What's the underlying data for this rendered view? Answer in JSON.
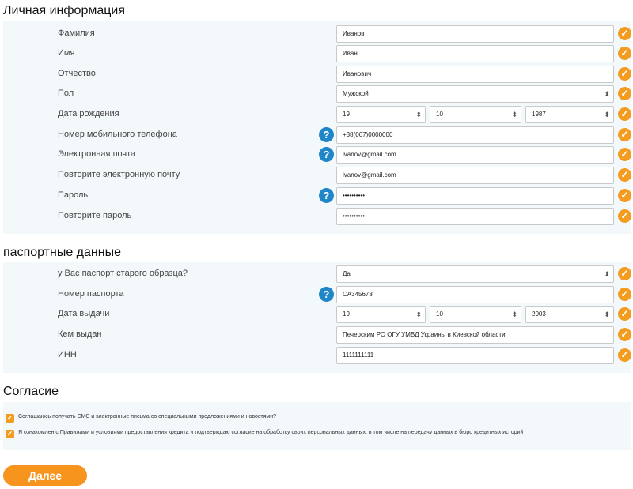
{
  "personal": {
    "title": "Личная информация",
    "fields": [
      {
        "label": "Фамилия",
        "value": "Иванов"
      },
      {
        "label": "Имя",
        "value": "Иван"
      },
      {
        "label": "Отчество",
        "value": "Иванович"
      },
      {
        "label": "Пол",
        "value": "Мужской"
      },
      {
        "label": "Дата рождения",
        "day": "19",
        "month": "10",
        "year": "1987"
      },
      {
        "label": "Номер мобильного телефона",
        "value": "+38(067)0000000"
      },
      {
        "label": "Электронная почта",
        "value": "ivanov@gmail.com"
      },
      {
        "label": "Повторите электронную почту",
        "value": "ivanov@gmail.com"
      },
      {
        "label": "Пароль",
        "value": "••••••••••"
      },
      {
        "label": "Повторите пароль",
        "value": "••••••••••"
      }
    ]
  },
  "passport": {
    "title": "паспортные данные",
    "fields": [
      {
        "label": "у Вас паспорт старого образца?",
        "value": "Да"
      },
      {
        "label": "Номер паспорта",
        "value": "CA345678"
      },
      {
        "label": "Дата выдачи",
        "day": "19",
        "month": "10",
        "year": "2003"
      },
      {
        "label": "Кем выдан",
        "value": "Печерским РО ОГУ УМВД Украины в Киевской области"
      },
      {
        "label": "ИНН",
        "value": "1111111111"
      }
    ]
  },
  "consent": {
    "title": "Согласие",
    "items": [
      {
        "text": "Соглашаюсь получать СМС и электронные письма со специальными предложениями и новостями?"
      },
      {
        "text": "Я ознакомлен с Правилами и условиями предоставления кредита и подтверждаю согласие на обработку своих персональных данных, в том числе на передачу данных в бюро кредитных историй"
      }
    ]
  },
  "icons": {
    "help": "?",
    "ok": "✓",
    "check": "✓"
  },
  "submit_label": "Далее",
  "colors": {
    "accent": "#f39c1f",
    "help": "#1f86c8",
    "panel": "#f3f8fb"
  }
}
